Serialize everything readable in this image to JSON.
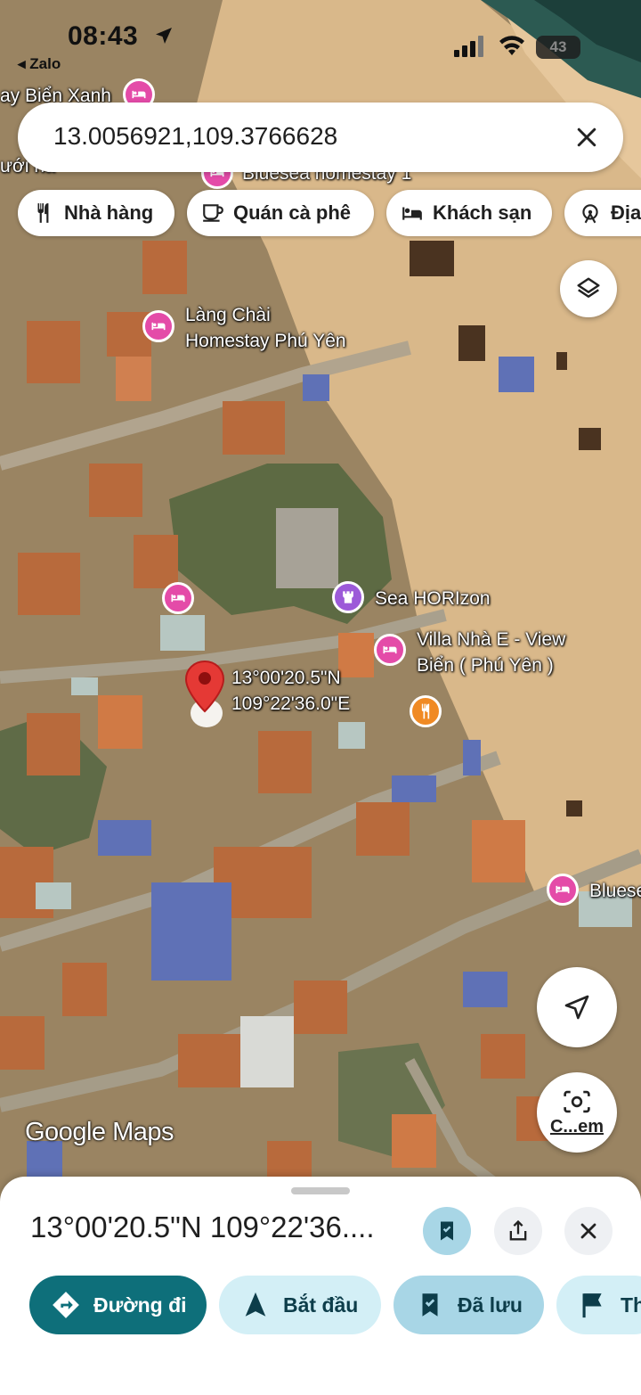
{
  "status_bar": {
    "time": "08:43",
    "back_app": "◂ Zalo",
    "battery": "43"
  },
  "search": {
    "query": "13.0056921,109.3766628"
  },
  "chips": [
    {
      "label": "Nhà hàng",
      "icon": "fork-knife-icon"
    },
    {
      "label": "Quán cà phê",
      "icon": "coffee-cup-icon"
    },
    {
      "label": "Khách sạn",
      "icon": "bed-icon"
    },
    {
      "label": "Địa",
      "icon": "attraction-icon"
    }
  ],
  "map": {
    "labels": {
      "bien_xanh": "ay Biển Xanh",
      "truoi": "ưới nà",
      "bluesea_1": "Bluesea homestay 1",
      "lang_chai_1": "Làng Chài",
      "lang_chai_2": "Homestay Phú Yên",
      "sea_horizon": "Sea HORIzon",
      "villa_1": "Villa Nhà E - View",
      "villa_2": "Biển ( Phú Yên )",
      "bluese": "Bluese",
      "pin_lat": "13°00'20.5\"N",
      "pin_lng": "109°22'36.0\"E"
    },
    "attribution": "Google Maps",
    "lens_label": "C...em"
  },
  "sheet": {
    "title": "13°00'20.5\"N 109°22'36....",
    "actions": [
      {
        "label": "Đường đi",
        "icon": "directions-icon"
      },
      {
        "label": "Bắt đầu",
        "icon": "navigation-arrow-icon"
      },
      {
        "label": "Đã lưu",
        "icon": "bookmark-icon"
      },
      {
        "label": "Th",
        "icon": "flag-icon"
      }
    ]
  },
  "colors": {
    "primary": "#0e6f7a",
    "secondary_chip": "#d3eff6",
    "saved": "#a8d6e6",
    "hotel_pin": "#e44ba8",
    "attraction_pin": "#9c5ad8",
    "food_pin": "#f08a24",
    "location_pin": "#e53935"
  }
}
